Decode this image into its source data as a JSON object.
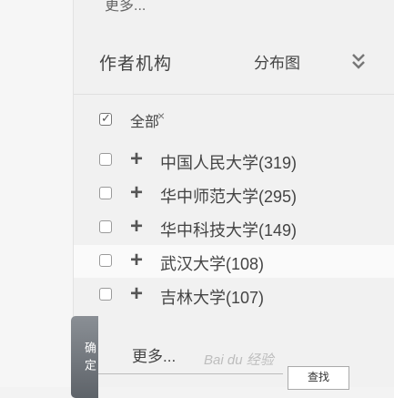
{
  "panel": {
    "top_more": "更多...",
    "header": {
      "title": "作者机构",
      "distribution_label": "分布图",
      "collapse_glyph": "«"
    },
    "all_item": {
      "label": "全部",
      "checked": true,
      "close_glyph": "×"
    },
    "institutions": [
      {
        "label": "中国人民大学(319)"
      },
      {
        "label": "华中师范大学(295)"
      },
      {
        "label": "华中科技大学(149)"
      },
      {
        "label": "武汉大学(108)"
      },
      {
        "label": "吉林大学(107)"
      }
    ],
    "more_label": "更多...",
    "search_button": "查找",
    "float_tab": "确定"
  },
  "watermark": "Bai du 经验",
  "colors": {
    "panel_bg": "#f1f1f1",
    "float_tab": "#6f747a"
  }
}
